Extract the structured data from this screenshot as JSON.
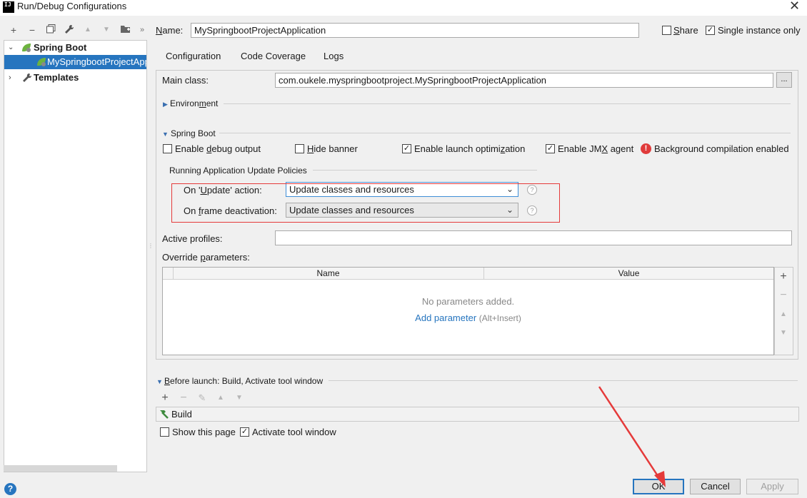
{
  "window": {
    "title": "Run/Debug Configurations",
    "logo_text": "IJ"
  },
  "toolbar": {
    "add": "+",
    "remove": "−",
    "copy": "⧉",
    "edit_templates": "🔧",
    "move_up": "▲",
    "move_down": "▼",
    "new_folder": "▸",
    "more": "»"
  },
  "tree": {
    "spring_boot": "Spring Boot",
    "app_item": "MySpringbootProjectApplication",
    "templates": "Templates"
  },
  "name": {
    "label_prefix": "",
    "label_u": "N",
    "label_rest": "ame:",
    "value": "MySpringbootProjectApplication"
  },
  "share": {
    "label_prefix": "",
    "label_u": "S",
    "label_rest": "hare",
    "checked": false
  },
  "single_instance": {
    "label": "Single instance only",
    "checked": true
  },
  "tabs": [
    "Configuration",
    "Code Coverage",
    "Logs"
  ],
  "main_class": {
    "label": "Main class:",
    "value": "com.oukele.myspringbootproject.MySpringbootProjectApplication",
    "browse": "..."
  },
  "environment": {
    "label_prefix": "Environ",
    "label_u": "m",
    "label_rest": "ent"
  },
  "spring_boot_section": {
    "label": "Spring Boot",
    "debug_output": {
      "prefix": "Enable ",
      "u": "d",
      "rest": "ebug output",
      "checked": false
    },
    "hide_banner": {
      "prefix": "",
      "u": "H",
      "rest": "ide banner",
      "checked": false
    },
    "launch_opt": {
      "prefix": "Enable launch optimi",
      "u": "z",
      "rest": "ation",
      "checked": true
    },
    "jmx": {
      "prefix": "Enable JM",
      "u": "X",
      "rest": " agent",
      "checked": true
    },
    "bg_compilation": "Background compilation enabled"
  },
  "update_policies": {
    "title": "Running Application Update Policies",
    "on_update": {
      "prefix": "On '",
      "u": "U",
      "rest": "pdate' action:",
      "value": "Update classes and resources"
    },
    "on_frame": {
      "prefix": "On ",
      "u": "f",
      "rest": "rame deactivation:",
      "value": "Update classes and resources"
    },
    "help": "?"
  },
  "active_profiles": {
    "label": "Active profiles:",
    "value": ""
  },
  "override_params": {
    "label_prefix": "Override ",
    "label_u": "p",
    "label_rest": "arameters:",
    "columns": [
      "Name",
      "Value"
    ],
    "empty": "No parameters added.",
    "add_link": "Add parameter",
    "shortcut": "(Alt+Insert)",
    "side_buttons": [
      "+",
      "−",
      "▲",
      "▼"
    ]
  },
  "before_launch": {
    "label_prefix": "",
    "label_u": "B",
    "label_rest": "efore launch: Build, Activate tool window",
    "buttons": [
      "+",
      "−",
      "✎",
      "▲",
      "▼"
    ],
    "item": "Build"
  },
  "show_page": {
    "label": "Show this page",
    "checked": false
  },
  "activate_tool": {
    "label": "Activate tool window",
    "checked": true
  },
  "buttons": {
    "ok": "OK",
    "cancel": "Cancel",
    "apply": "Apply"
  },
  "help_icon": "?",
  "colors": {
    "accent": "#2675bf",
    "annotation_red": "#e53a3a",
    "spring_green": "#6db33f"
  },
  "annotation": {
    "arrow": "red arrow pointing to OK button"
  }
}
